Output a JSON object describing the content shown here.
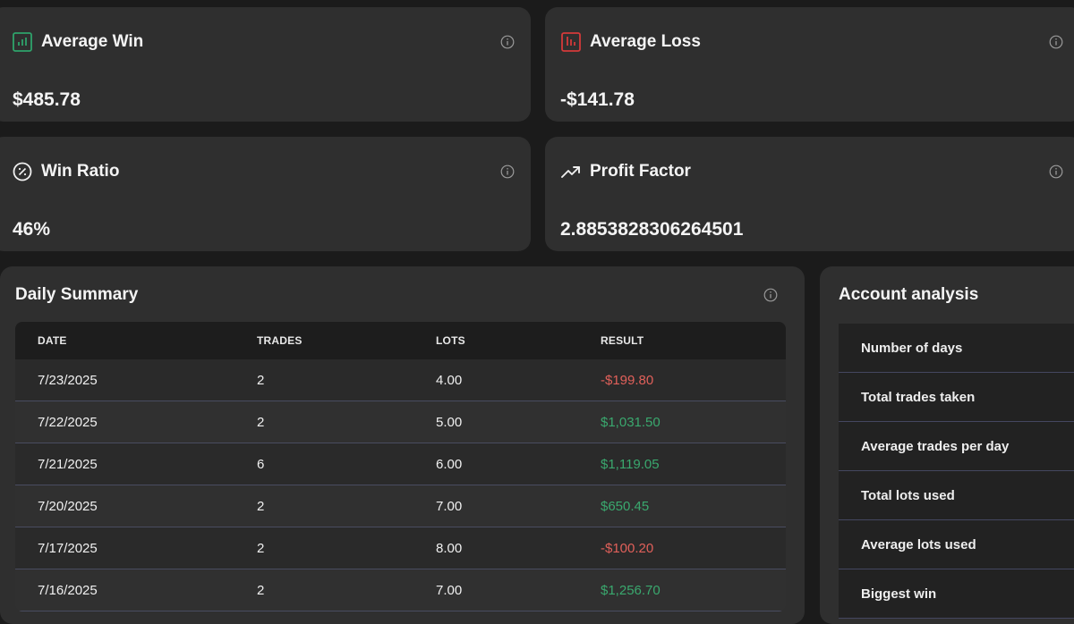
{
  "stats": {
    "average_win": {
      "title": "Average Win",
      "value": "$485.78",
      "icon": "bar-chart-icon",
      "color": "#2fa36b"
    },
    "average_loss": {
      "title": "Average Loss",
      "value": "-$141.78",
      "icon": "bar-chart-icon",
      "color": "#d43a3a"
    },
    "win_ratio": {
      "title": "Win Ratio",
      "value": "46%",
      "icon": "percent-icon"
    },
    "profit_factor": {
      "title": "Profit Factor",
      "value": "2.8853828306264501",
      "icon": "trending-up-icon"
    }
  },
  "daily_summary": {
    "title": "Daily Summary",
    "columns": [
      "DATE",
      "TRADES",
      "LOTS",
      "RESULT"
    ],
    "rows": [
      {
        "date": "7/23/2025",
        "trades": "2",
        "lots": "4.00",
        "result": "-$199.80",
        "status": "negative"
      },
      {
        "date": "7/22/2025",
        "trades": "2",
        "lots": "5.00",
        "result": "$1,031.50",
        "status": "positive"
      },
      {
        "date": "7/21/2025",
        "trades": "6",
        "lots": "6.00",
        "result": "$1,119.05",
        "status": "positive"
      },
      {
        "date": "7/20/2025",
        "trades": "2",
        "lots": "7.00",
        "result": "$650.45",
        "status": "positive"
      },
      {
        "date": "7/17/2025",
        "trades": "2",
        "lots": "8.00",
        "result": "-$100.20",
        "status": "negative"
      },
      {
        "date": "7/16/2025",
        "trades": "2",
        "lots": "7.00",
        "result": "$1,256.70",
        "status": "positive"
      }
    ]
  },
  "account_analysis": {
    "title": "Account analysis",
    "items": [
      "Number of days",
      "Total trades taken",
      "Average trades per day",
      "Total lots used",
      "Average lots used",
      "Biggest win"
    ]
  },
  "colors": {
    "positive": "#3aa86e",
    "negative": "#e0605a",
    "card_bg": "#2f2f2f",
    "page_bg": "#1b1b1b"
  }
}
